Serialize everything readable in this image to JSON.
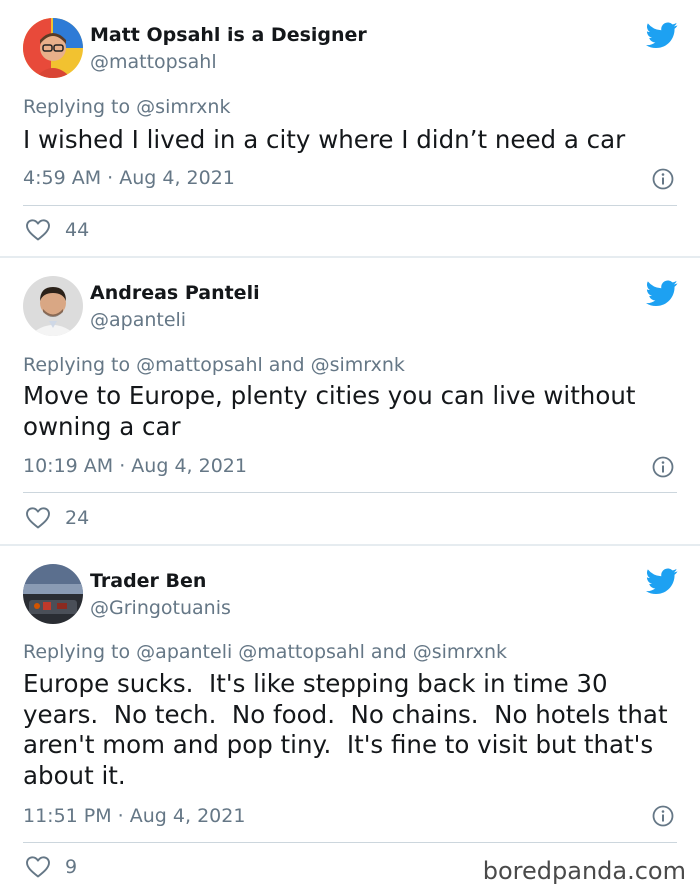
{
  "tweets": [
    {
      "name": "Matt Opsahl is a Designer",
      "handle": "@mattopsahl",
      "replying_prefix": "Replying to",
      "replying_mentions": "@simrxnk",
      "text": "I wished I lived in a city where I didn’t need a car",
      "time": "4:59 AM · Aug 4, 2021",
      "likes": "44"
    },
    {
      "name": "Andreas Panteli",
      "handle": "@apanteli",
      "replying_prefix": "Replying to",
      "replying_mentions": "@mattopsahl and @simrxnk",
      "text": "Move to Europe, plenty cities you can live without owning a car",
      "time": "10:19 AM · Aug 4, 2021",
      "likes": "24"
    },
    {
      "name": "Trader Ben",
      "handle": "@Gringotuanis",
      "replying_prefix": "Replying to",
      "replying_mentions": "@apanteli @mattopsahl and @simrxnk",
      "text": "Europe sucks.  It's like stepping back in time 30 years.  No tech.  No food.  No chains.  No hotels that aren't mom and pop tiny.  It's fine to visit but that's about it.",
      "time": "11:51 PM · Aug 4, 2021",
      "likes": "9"
    }
  ],
  "watermark": "boredpanda.com",
  "colors": {
    "twitter_blue": "#1da1f2",
    "secondary_text": "#657786",
    "primary_text": "#14171a",
    "background": "#e6ecf0"
  },
  "icons": [
    "twitter-bird-icon",
    "info-icon",
    "heart-icon"
  ]
}
